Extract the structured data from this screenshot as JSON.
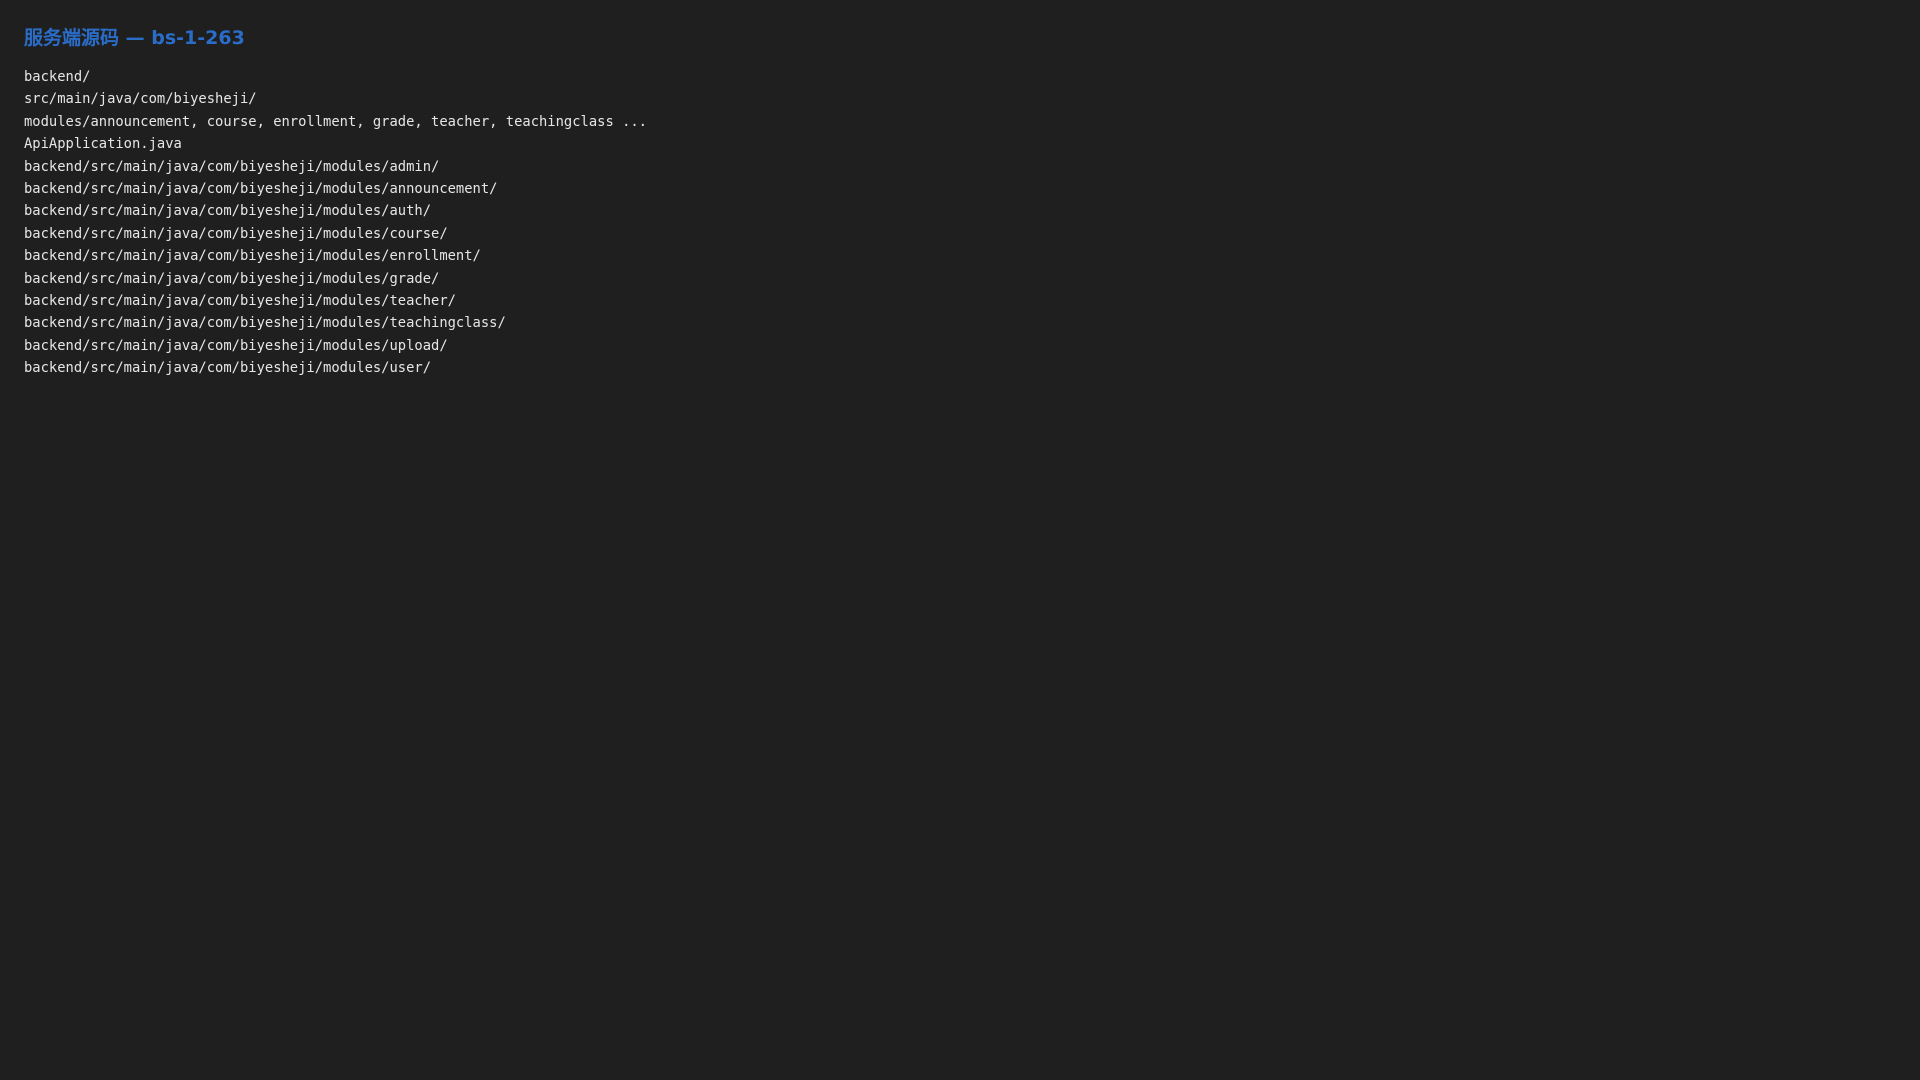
{
  "page": {
    "title": "服务端源码 — bs-1-263",
    "lines": [
      "backend/",
      "src/main/java/com/biyesheji/",
      "modules/announcement, course, enrollment, grade, teacher, teachingclass ...",
      "ApiApplication.java",
      "backend/src/main/java/com/biyesheji/modules/admin/",
      "backend/src/main/java/com/biyesheji/modules/announcement/",
      "backend/src/main/java/com/biyesheji/modules/auth/",
      "backend/src/main/java/com/biyesheji/modules/course/",
      "backend/src/main/java/com/biyesheji/modules/enrollment/",
      "backend/src/main/java/com/biyesheji/modules/grade/",
      "backend/src/main/java/com/biyesheji/modules/teacher/",
      "backend/src/main/java/com/biyesheji/modules/teachingclass/",
      "backend/src/main/java/com/biyesheji/modules/upload/",
      "backend/src/main/java/com/biyesheji/modules/user/"
    ]
  },
  "colors": {
    "background": "#1f1f1f",
    "title": "#2a6dc9",
    "text": "#e6e6e6"
  }
}
